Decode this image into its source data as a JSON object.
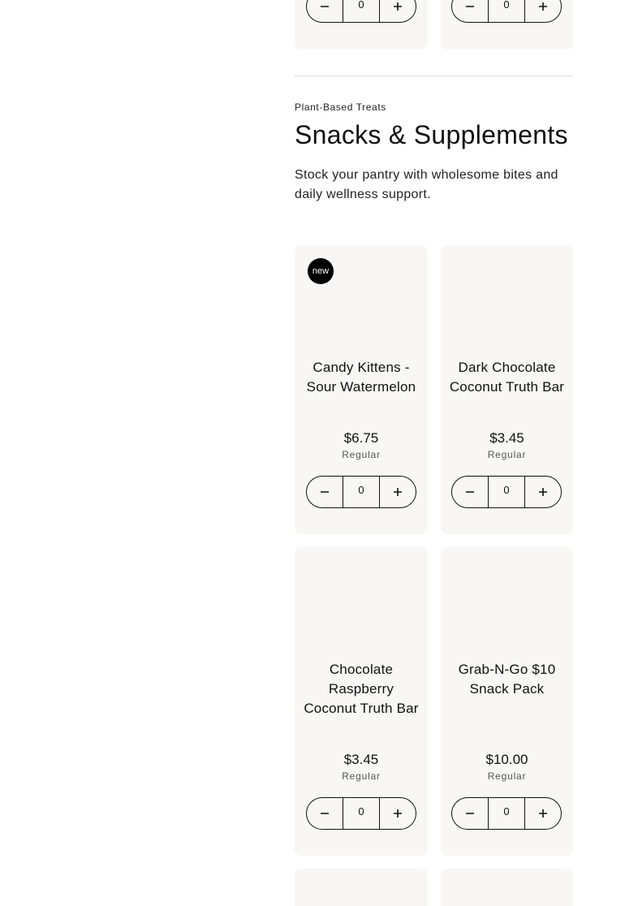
{
  "section": {
    "eyebrow": "Plant-Based Treats",
    "title": "Snacks & Supplements",
    "description": "Stock your pantry with wholesome bites and daily wellness support."
  },
  "top_row": [
    {
      "qty": "0"
    },
    {
      "qty": "0"
    }
  ],
  "products": [
    {
      "name": "Candy Kittens - Sour Watermelon",
      "price": "$6.75",
      "price_note": "Regular",
      "qty": "0",
      "badge": "new"
    },
    {
      "name": "Dark Chocolate Coconut Truth Bar",
      "price": "$3.45",
      "price_note": "Regular",
      "qty": "0"
    },
    {
      "name": "Chocolate Raspberry Coconut Truth Bar",
      "price": "$3.45",
      "price_note": "Regular",
      "qty": "0"
    },
    {
      "name": "Grab-N-Go $10 Snack Pack",
      "price": "$10.00",
      "price_note": "Regular",
      "qty": "0"
    }
  ],
  "icons": {
    "decrement": "minus-icon",
    "increment": "plus-icon"
  }
}
